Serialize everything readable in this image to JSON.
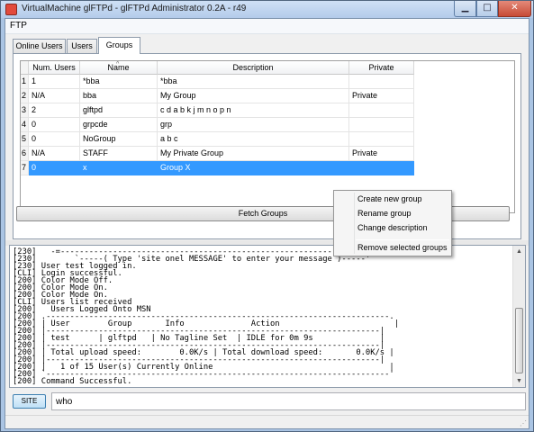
{
  "window": {
    "title": "VirtualMachine glFTPd - glFTPd Administrator 0.2A - r49",
    "min_icon": "minimize-icon",
    "max_icon": "maximize-icon",
    "close_icon": "close-icon",
    "min_glyph": "▁",
    "max_glyph": "□",
    "close_glyph": "✕",
    "app_icon": "app-icon"
  },
  "menu": {
    "ftp": "FTP"
  },
  "tabs": [
    {
      "label": "Online Users"
    },
    {
      "label": "Users"
    },
    {
      "label": "Groups",
      "selected": true
    }
  ],
  "grid": {
    "columns": [
      "",
      "Num. Users",
      "Name",
      "Description",
      "Private"
    ],
    "sort_glyph": "^",
    "rows": [
      {
        "n": "1",
        "num_users": "1",
        "name": "*bba",
        "description": "*bba",
        "private": ""
      },
      {
        "n": "2",
        "num_users": "N/A",
        "name": "bba",
        "description": "My Group",
        "private": "Private"
      },
      {
        "n": "3",
        "num_users": "2",
        "name": "glftpd",
        "description": "c d a b k j m n o p n",
        "private": ""
      },
      {
        "n": "4",
        "num_users": "0",
        "name": "grpcde",
        "description": "grp",
        "private": ""
      },
      {
        "n": "5",
        "num_users": "0",
        "name": "NoGroup",
        "description": "a b c",
        "private": ""
      },
      {
        "n": "6",
        "num_users": "N/A",
        "name": "STAFF",
        "description": "My Private Group",
        "private": "Private"
      },
      {
        "n": "7",
        "num_users": "0",
        "name": "x",
        "description": "Group X",
        "private": "",
        "selected": true
      }
    ]
  },
  "fetch_button": "Fetch Groups",
  "context_menu": {
    "items": [
      "Create new group",
      "Rename group",
      "Change description",
      "Remove selected groups"
    ]
  },
  "log": {
    "lines": [
      "[230]   -=------------------------------------------------------------------------------=-",
      "[230]        `-----( Type 'site onel MESSAGE' to enter your message )-----'",
      "[230] User test logged in.",
      "[CLI] Login successful.",
      "[200] Color Mode Off.",
      "[200] Color Mode On.",
      "[200] Color Mode On.",
      "[CLI] Users list received",
      "[200]   Users Logged Onto MSN",
      "[200] .------------------------------------------------------------------------.",
      "[200] | User        Group       Info              Action                        |",
      "[200] |----------------------------------------------------------------------|",
      "[200] | test      | glftpd   | No Tagline Set  | IDLE for 0m 9s              |",
      "[200] |----------------------------------------------------------------------|",
      "[200] | Total upload speed:        0.0K/s | Total download speed:       0.0K/s |",
      "[200] |----------------------------------------------------------------------|",
      "[200] |   1 of 15 User(s) Currently Online                                     |",
      "[200] `------------------------------------------------------------------------'",
      "[200] Command Successful."
    ],
    "scroll_up_glyph": "▲",
    "scroll_down_glyph": "▼"
  },
  "command": {
    "site_button": "SITE",
    "input_value": "who"
  },
  "status": {
    "grip_glyph": "⋰"
  },
  "colors": {
    "selection": "#3399ff",
    "title_bar": "#b3cbea",
    "close_button": "#c74b36"
  }
}
